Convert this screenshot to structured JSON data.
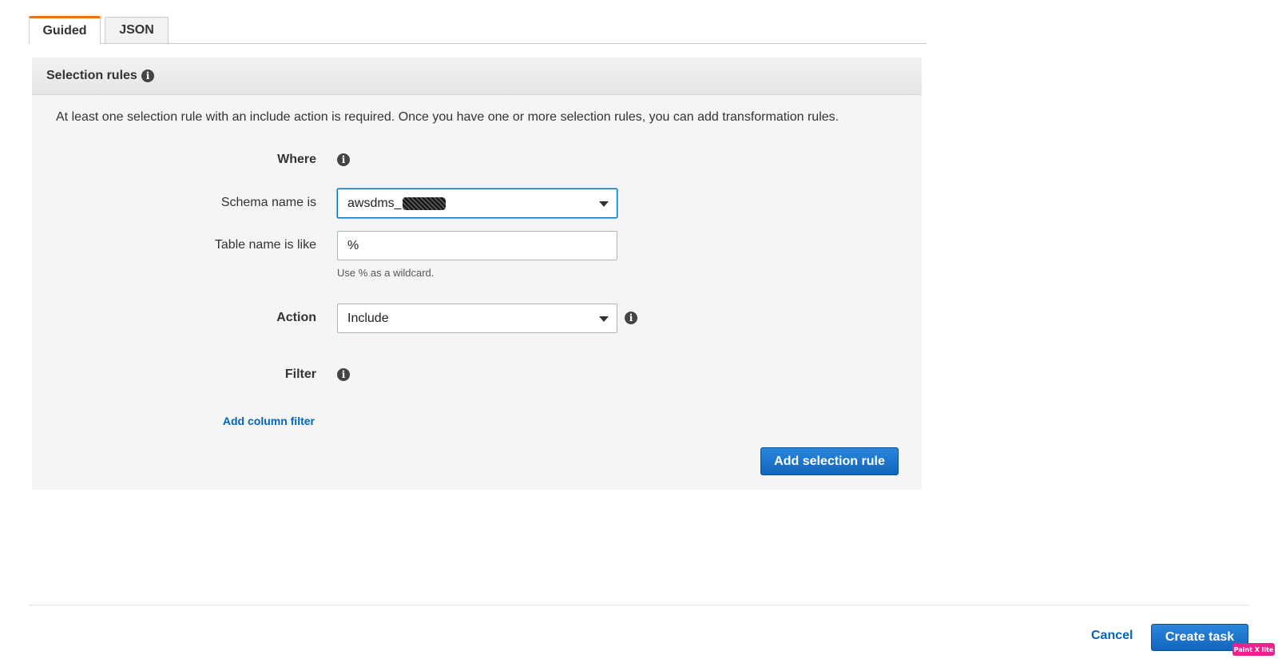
{
  "tabs": [
    {
      "label": "Guided",
      "active": true
    },
    {
      "label": "JSON",
      "active": false
    }
  ],
  "panel": {
    "title": "Selection rules",
    "description": "At least one selection rule with an include action is required. Once you have one or more selection rules, you can add transformation rules."
  },
  "form": {
    "where_label": "Where",
    "schema_label": "Schema name is",
    "schema_value": "awsdms_",
    "table_label": "Table name is like",
    "table_value": "%",
    "table_hint": "Use % as a wildcard.",
    "action_label": "Action",
    "action_value": "Include",
    "filter_label": "Filter",
    "add_column_filter": "Add column filter",
    "add_selection_rule": "Add selection rule"
  },
  "footer": {
    "cancel": "Cancel",
    "create_task": "Create task"
  },
  "badge": {
    "label": "Paint X lite"
  },
  "icons": {
    "info": "info-icon",
    "dropdown": "caret-down-icon"
  },
  "colors": {
    "tab_active_accent": "#ec7211",
    "primary_button": "#1166bb",
    "link": "#0066c0",
    "panel_bg": "#f5f5f5"
  }
}
